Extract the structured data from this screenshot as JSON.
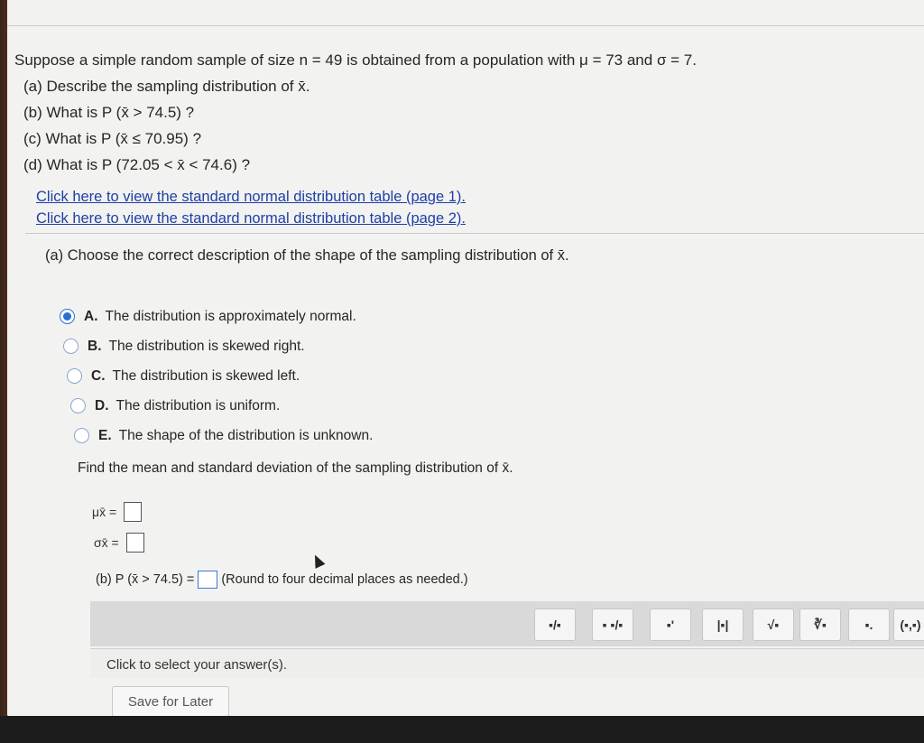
{
  "question": {
    "intro": "Suppose a simple random sample of size n = 49 is obtained from a population with μ = 73 and σ = 7.",
    "parts": [
      "(a) Describe the sampling distribution of x̄.",
      "(b) What is P (x̄ > 74.5) ?",
      "(c) What is P (x̄ ≤ 70.95) ?",
      "(d) What is P (72.05 < x̄ < 74.6) ?"
    ]
  },
  "links": [
    "Click here to view the standard normal distribution table (page 1).",
    "Click here to view the standard normal distribution table (page 2)."
  ],
  "part_a": {
    "prompt": "(a) Choose the correct description of the shape of the sampling distribution of x̄.",
    "options": [
      {
        "letter": "A.",
        "text": "The distribution is approximately normal.",
        "selected": true
      },
      {
        "letter": "B.",
        "text": "The distribution is skewed right.",
        "selected": false
      },
      {
        "letter": "C.",
        "text": "The distribution is skewed left.",
        "selected": false
      },
      {
        "letter": "D.",
        "text": "The distribution is uniform.",
        "selected": false
      },
      {
        "letter": "E.",
        "text": "The shape of the distribution is unknown.",
        "selected": false
      }
    ]
  },
  "find": {
    "prompt": "Find the mean and standard deviation of the sampling distribution of x̄.",
    "mu_label": "μx̄ =",
    "sigma_label": "σx̄ ="
  },
  "part_b": {
    "label": "(b) P (x̄ > 74.5) =",
    "hint": "(Round to four decimal places as needed.)"
  },
  "toolbar": {
    "buttons": [
      "fraction-icon",
      "mixed-number-icon",
      "superscript-icon",
      "absolute-value-icon",
      "square-root-icon",
      "nth-root-icon",
      "decimal-icon",
      "interval-icon"
    ],
    "labels": [
      "▪/▪",
      "▪ ▪/▪",
      "▪'",
      "|▪|",
      "√▪",
      "∛▪",
      "▪.",
      "(▪,▪)"
    ]
  },
  "status": {
    "text": "Click to select your answer(s)."
  },
  "save_button": "Save for Later"
}
